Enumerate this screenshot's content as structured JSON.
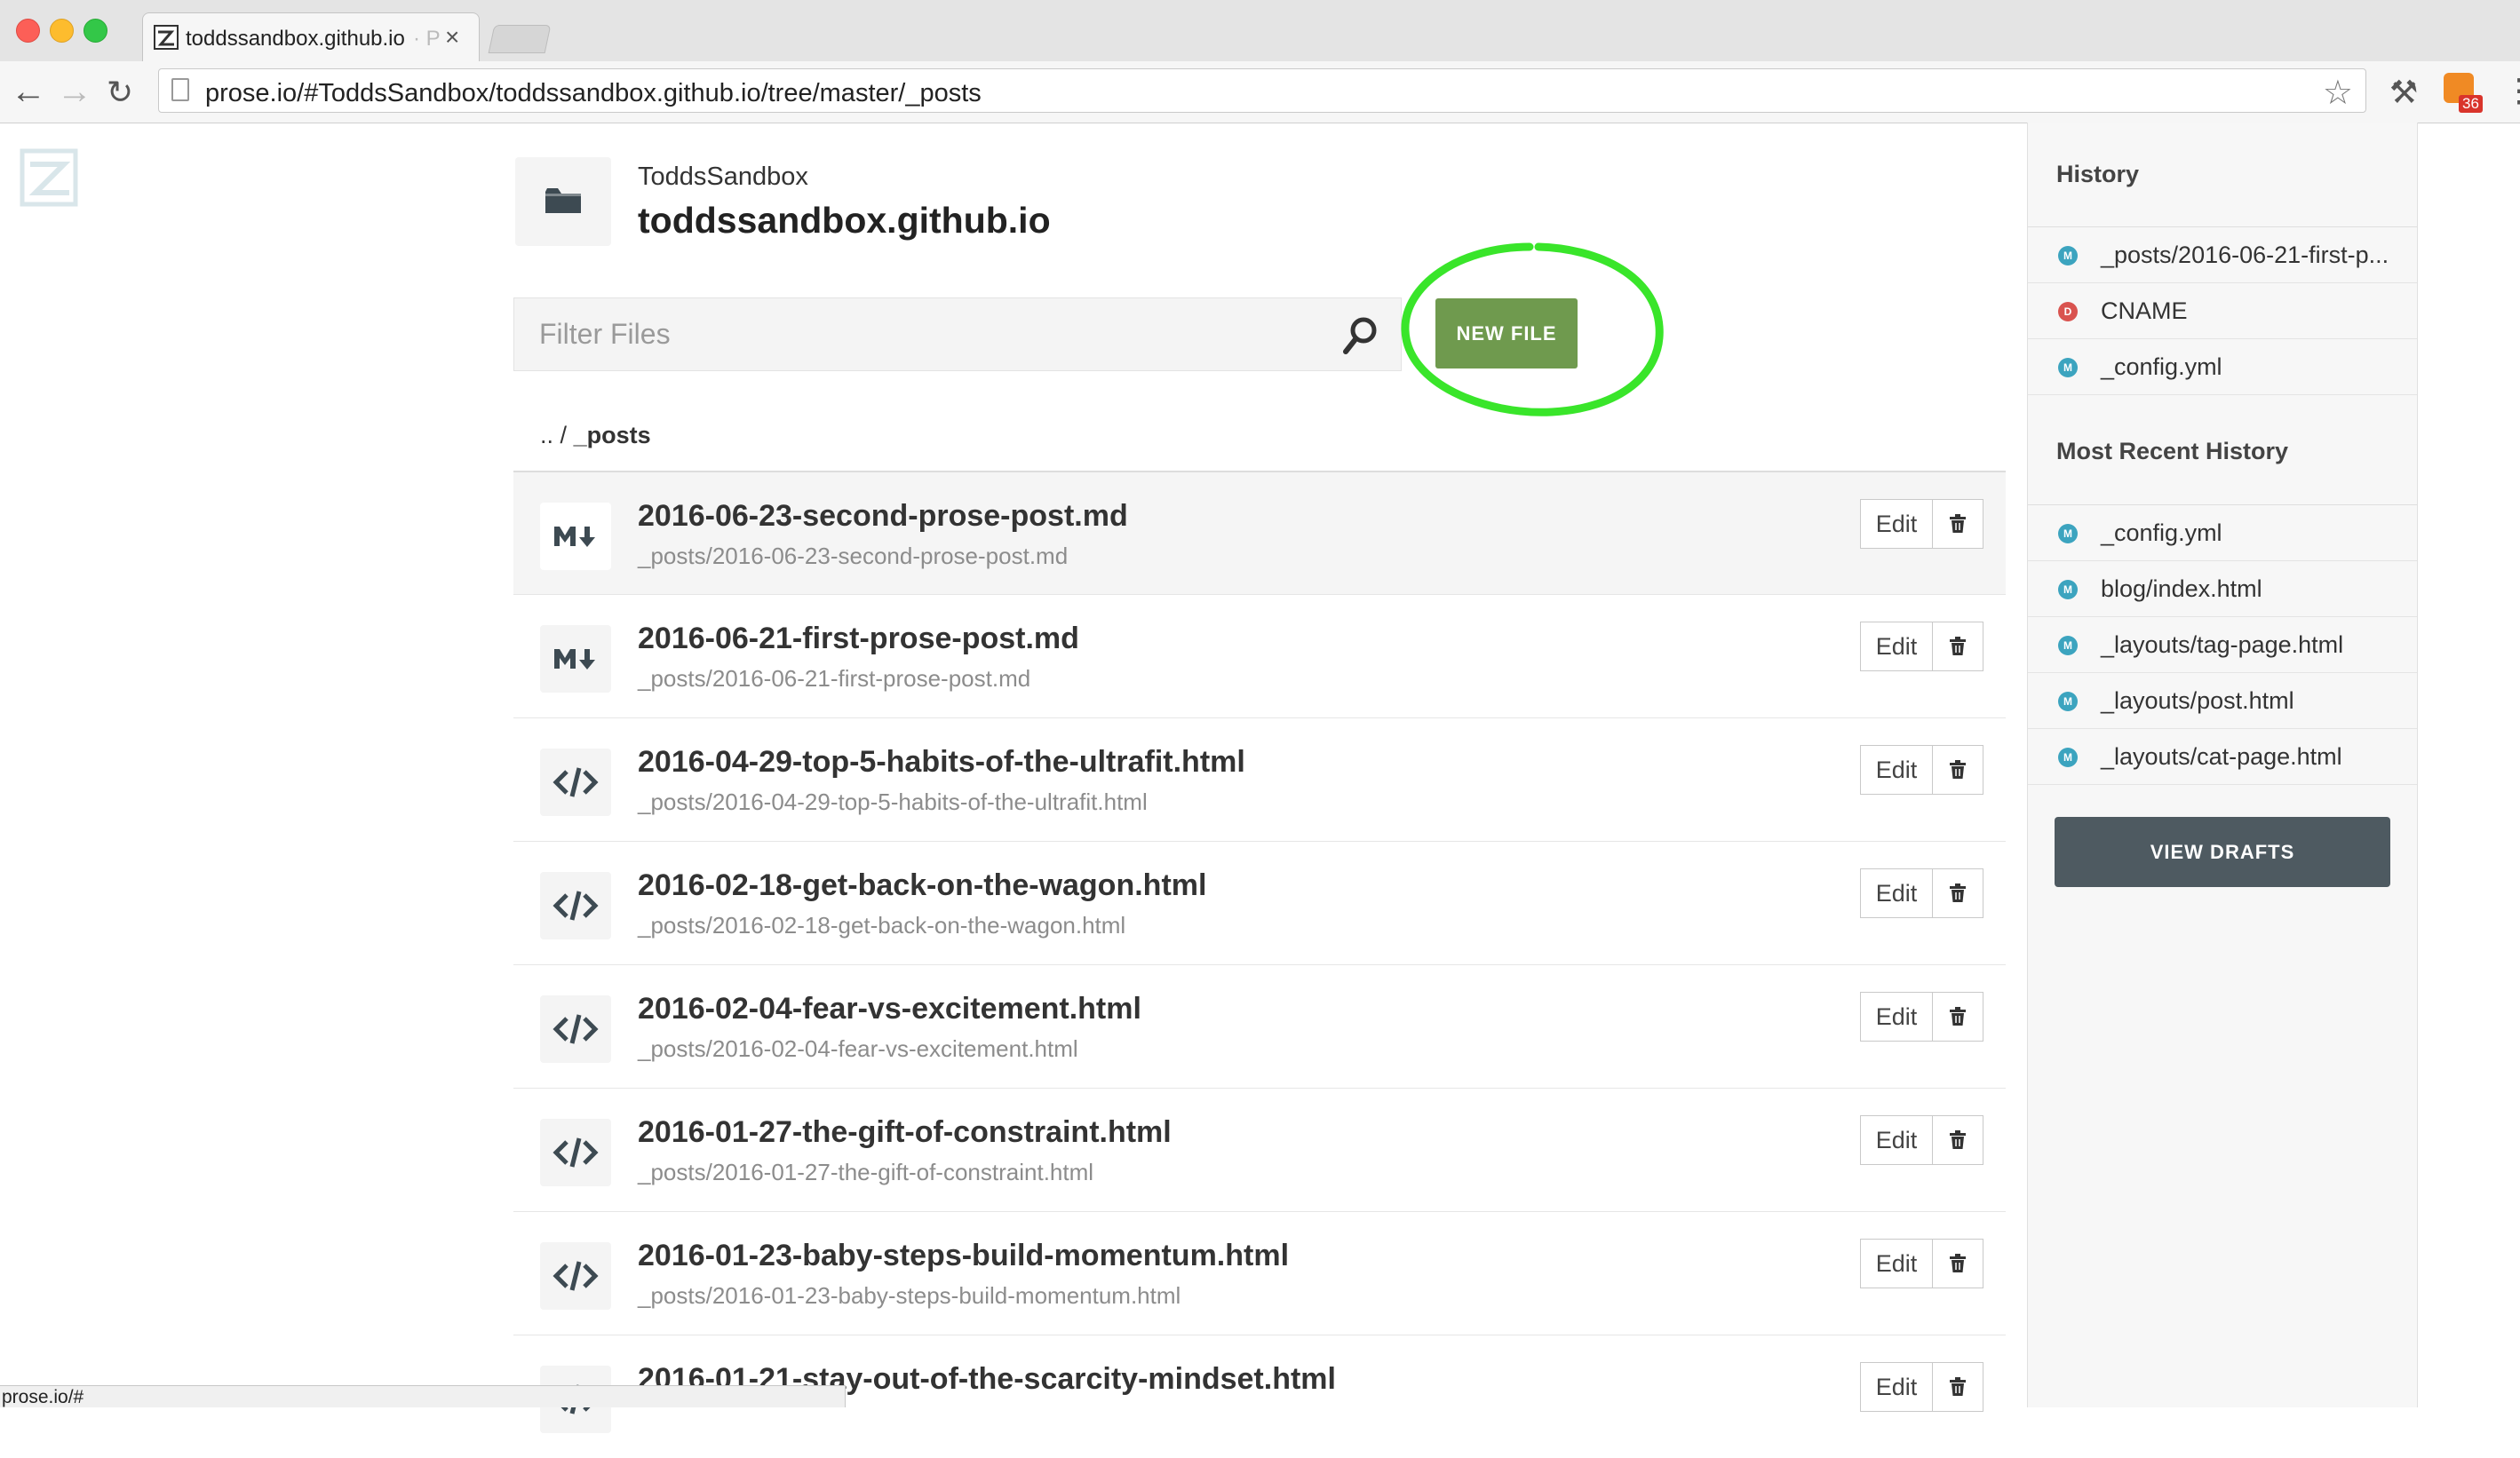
{
  "browser": {
    "tab_title": "toddssandbox.github.io",
    "tab_title_faded": "· P",
    "tab_close": "×",
    "url": "prose.io/#ToddsSandbox/toddssandbox.github.io/tree/master/_posts",
    "extension_badge": "36",
    "status_text": "prose.io/#"
  },
  "repo": {
    "owner": "ToddsSandbox",
    "name": "toddssandbox.github.io"
  },
  "filter": {
    "placeholder": "Filter Files"
  },
  "new_file_label": "NEW FILE",
  "breadcrumb": {
    "up": "..",
    "separator": "/",
    "current": "_posts"
  },
  "file_edit_label": "Edit",
  "files": [
    {
      "title": "2016-06-23-second-prose-post.md",
      "path": "_posts/2016-06-23-second-prose-post.md",
      "icon": "markdown-icon"
    },
    {
      "title": "2016-06-21-first-prose-post.md",
      "path": "_posts/2016-06-21-first-prose-post.md",
      "icon": "markdown-icon"
    },
    {
      "title": "2016-04-29-top-5-habits-of-the-ultrafit.html",
      "path": "_posts/2016-04-29-top-5-habits-of-the-ultrafit.html",
      "icon": "code-icon"
    },
    {
      "title": "2016-02-18-get-back-on-the-wagon.html",
      "path": "_posts/2016-02-18-get-back-on-the-wagon.html",
      "icon": "code-icon"
    },
    {
      "title": "2016-02-04-fear-vs-excitement.html",
      "path": "_posts/2016-02-04-fear-vs-excitement.html",
      "icon": "code-icon"
    },
    {
      "title": "2016-01-27-the-gift-of-constraint.html",
      "path": "_posts/2016-01-27-the-gift-of-constraint.html",
      "icon": "code-icon"
    },
    {
      "title": "2016-01-23-baby-steps-build-momentum.html",
      "path": "_posts/2016-01-23-baby-steps-build-momentum.html",
      "icon": "code-icon"
    },
    {
      "title": "2016-01-21-stay-out-of-the-scarcity-mindset.html",
      "path": "",
      "icon": "code-icon"
    }
  ],
  "sidebar": {
    "history_title": "History",
    "history": [
      {
        "label": "_posts/2016-06-21-first-p...",
        "badge": "M",
        "color": "#3ca4bf"
      },
      {
        "label": "CNAME",
        "badge": "D",
        "color": "#d9534f"
      },
      {
        "label": "_config.yml",
        "badge": "M",
        "color": "#3ca4bf"
      }
    ],
    "recent_title": "Most Recent History",
    "recent": [
      {
        "label": "_config.yml",
        "badge": "M",
        "color": "#3ca4bf"
      },
      {
        "label": "blog/index.html",
        "badge": "M",
        "color": "#3ca4bf"
      },
      {
        "label": "_layouts/tag-page.html",
        "badge": "M",
        "color": "#3ca4bf"
      },
      {
        "label": "_layouts/post.html",
        "badge": "M",
        "color": "#3ca4bf"
      },
      {
        "label": "_layouts/cat-page.html",
        "badge": "M",
        "color": "#3ca4bf"
      }
    ],
    "view_drafts_label": "VIEW DRAFTS"
  },
  "colors": {
    "new_file_button": "#6f9a4e",
    "highlight_circle": "#39e52a",
    "view_drafts_button": "#4e5a61"
  }
}
